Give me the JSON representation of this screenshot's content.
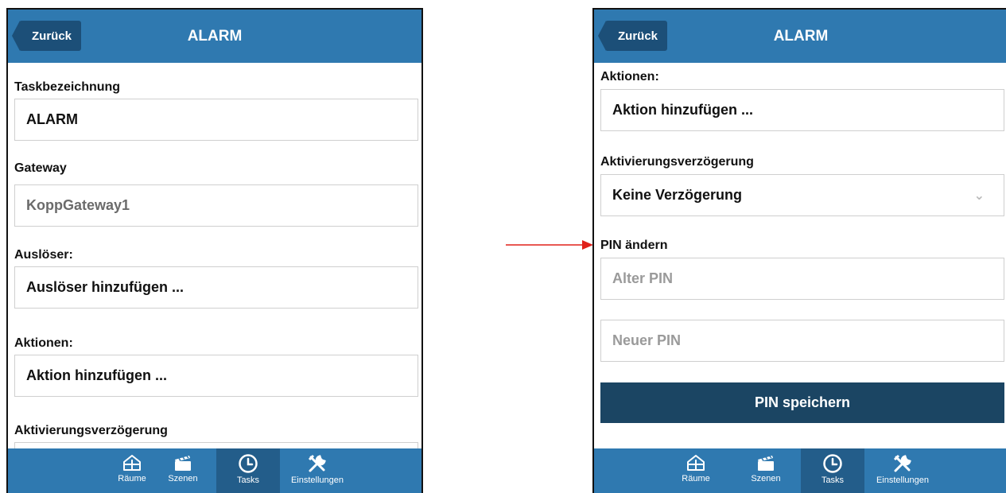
{
  "colors": {
    "header_blue": "#2f79b0",
    "back_button": "#1c4f78",
    "save_button": "#1b4563",
    "active_tab": "#235d8a",
    "arrow": "#e0211a"
  },
  "left": {
    "header": {
      "back_label": "Zurück",
      "title": "ALARM"
    },
    "form": {
      "task_label": "Taskbezeichnung",
      "task_value": "ALARM",
      "gateway_label": "Gateway",
      "gateway_value": "KoppGateway1",
      "trigger_label": "Auslöser:",
      "trigger_add": "Auslöser hinzufügen ...",
      "actions_label": "Aktionen:",
      "actions_add": "Aktion hinzufügen ...",
      "delay_label": "Aktivierungsverzögerung"
    },
    "tabs": [
      {
        "label": "Räume",
        "icon": "house-icon"
      },
      {
        "label": "Szenen",
        "icon": "clapperboard-icon"
      },
      {
        "label": "Tasks",
        "icon": "clock-icon",
        "active": true
      },
      {
        "label": "Einstellungen",
        "icon": "tools-icon"
      }
    ]
  },
  "right": {
    "header": {
      "back_label": "Zurück",
      "title": "ALARM"
    },
    "form": {
      "actions_label": "Aktionen:",
      "actions_add": "Aktion hinzufügen ...",
      "delay_label": "Aktivierungsverzögerung",
      "delay_value": "Keine Verzögerung",
      "pin_label": "PIN ändern",
      "old_pin_placeholder": "Alter PIN",
      "new_pin_placeholder": "Neuer PIN",
      "save_label": "PIN speichern"
    },
    "tabs": [
      {
        "label": "Räume",
        "icon": "house-icon"
      },
      {
        "label": "Szenen",
        "icon": "clapperboard-icon"
      },
      {
        "label": "Tasks",
        "icon": "clock-icon",
        "active": true
      },
      {
        "label": "Einstellungen",
        "icon": "tools-icon"
      }
    ]
  }
}
